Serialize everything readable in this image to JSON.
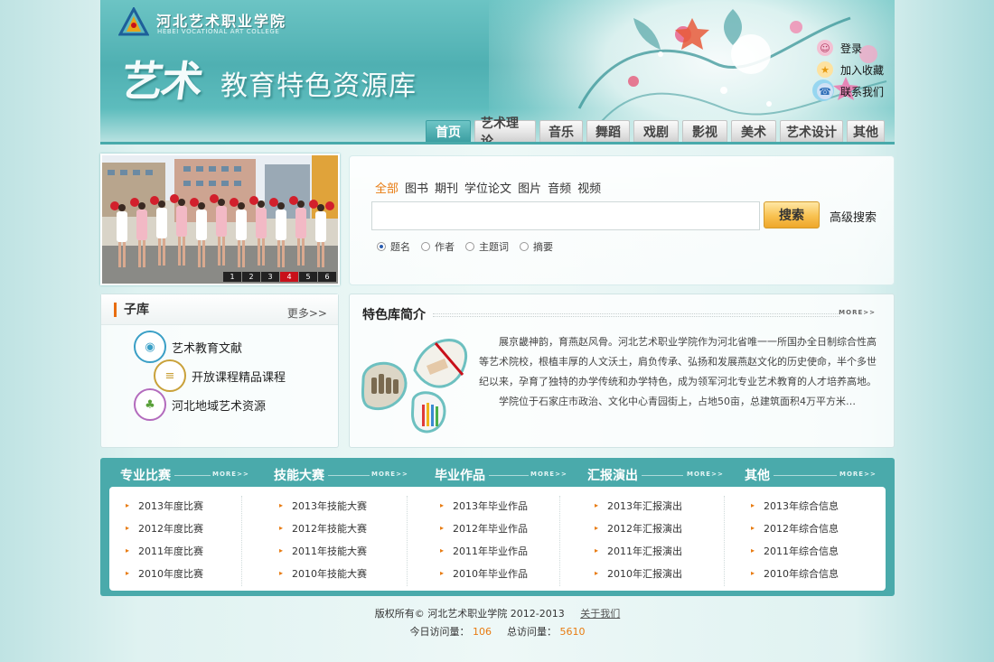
{
  "header": {
    "logo_cn": "河北艺术职业学院",
    "logo_en": "HEBEI VOCATIONAL ART COLLEGE",
    "title_art": "艺术",
    "title_rest": "教育特色资源库",
    "links": [
      {
        "label": "登录",
        "icon": "user-icon",
        "color": "#e57aa0"
      },
      {
        "label": "加入收藏",
        "icon": "star-icon",
        "color": "#f2b21a"
      },
      {
        "label": "联系我们",
        "icon": "phone-icon",
        "color": "#2f6fb8"
      }
    ]
  },
  "nav": {
    "tabs": [
      {
        "label": "首页",
        "active": true
      },
      {
        "label": "艺术理论"
      },
      {
        "label": "音乐"
      },
      {
        "label": "舞蹈"
      },
      {
        "label": "戏剧"
      },
      {
        "label": "影视"
      },
      {
        "label": "美术"
      },
      {
        "label": "艺术设计"
      },
      {
        "label": "其他"
      }
    ]
  },
  "slider": {
    "pages": [
      "1",
      "2",
      "3",
      "4",
      "5",
      "6"
    ],
    "active_page": "4"
  },
  "search": {
    "types": [
      "全部",
      "图书",
      "期刊",
      "学位论文",
      "图片",
      "音频",
      "视频"
    ],
    "active_type": "全部",
    "query": "",
    "button": "搜索",
    "advanced": "高级搜索",
    "scopes": [
      "题名",
      "作者",
      "主题词",
      "摘要"
    ],
    "checked_scope": "题名"
  },
  "sublib": {
    "title": "子库",
    "more": "更多>>",
    "items": [
      {
        "label": "艺术教育文献",
        "icon": "book-globe-icon",
        "color": "#3a9fc6"
      },
      {
        "label": "开放课程精品课程",
        "icon": "books-icon",
        "color": "#c9a13a"
      },
      {
        "label": "河北地域艺术资源",
        "icon": "tree-icon",
        "color": "#b36bbd"
      }
    ]
  },
  "intro": {
    "title": "特色库简介",
    "more": "MORE>>",
    "paragraphs": [
      "展京畿神韵，育燕赵风骨。河北艺术职业学院作为河北省唯一一所国办全日制综合性高等艺术院校，根植丰厚的人文沃土，肩负传承、弘扬和发展燕赵文化的历史使命，半个多世纪以来，孕育了独特的办学传统和办学特色，成为领军河北专业艺术教育的人才培养高地。",
      "学院位于石家庄市政治、文化中心青园街上，占地50亩，总建筑面积4万平方米…"
    ]
  },
  "categories": [
    {
      "title": "专业比赛",
      "more": "MORE>>",
      "items": [
        "2013年度比赛",
        "2012年度比赛",
        "2011年度比赛",
        "2010年度比赛"
      ]
    },
    {
      "title": "技能大赛",
      "more": "MORE>>",
      "items": [
        "2013年技能大赛",
        "2012年技能大赛",
        "2011年技能大赛",
        "2010年技能大赛"
      ]
    },
    {
      "title": "毕业作品",
      "more": "MORE>>",
      "items": [
        "2013年毕业作品",
        "2012年毕业作品",
        "2011年毕业作品",
        "2010年毕业作品"
      ]
    },
    {
      "title": "汇报演出",
      "more": "MORE>>",
      "items": [
        "2013年汇报演出",
        "2012年汇报演出",
        "2011年汇报演出",
        "2010年汇报演出"
      ]
    },
    {
      "title": "其他",
      "more": "MORE>>",
      "items": [
        "2013年综合信息",
        "2012年综合信息",
        "2011年综合信息",
        "2010年综合信息"
      ]
    }
  ],
  "footer": {
    "copyright": "版权所有© 河北艺术职业学院  2012-2013",
    "about": "关于我们",
    "today_label": "今日访问量：",
    "today_value": "106",
    "total_label": "总访问量：",
    "total_value": "5610"
  },
  "colors": {
    "teal": "#4aaaab",
    "accent_orange": "#e87b10",
    "slide_active": "#c8101a"
  }
}
